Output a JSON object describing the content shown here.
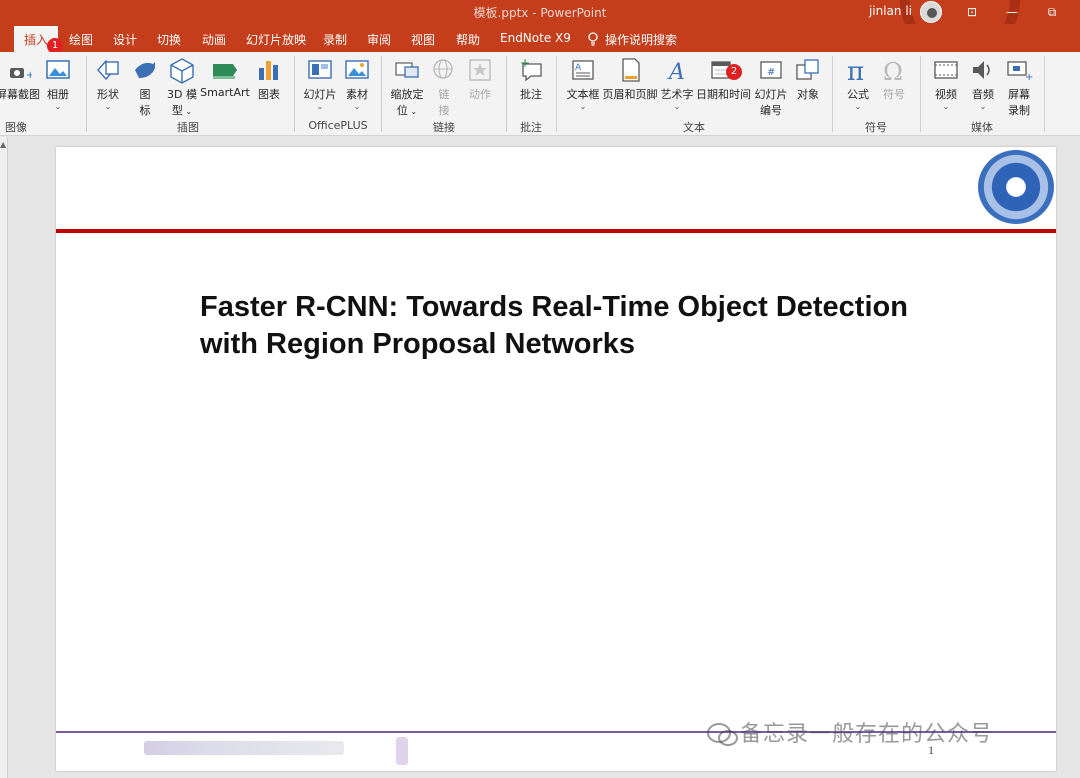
{
  "titlebar": {
    "document_title": "模板.pptx  -  PowerPoint",
    "user_name": "jinlan li",
    "win_buttons": [
      "⊡",
      "—",
      "⧉"
    ]
  },
  "tabs": [
    {
      "label": "插入",
      "active": true
    },
    {
      "label": "绘图"
    },
    {
      "label": "设计"
    },
    {
      "label": "切换"
    },
    {
      "label": "动画"
    },
    {
      "label": "幻灯片放映"
    },
    {
      "label": "录制"
    },
    {
      "label": "审阅"
    },
    {
      "label": "视图"
    },
    {
      "label": "帮助"
    },
    {
      "label": "EndNote X9"
    },
    {
      "label": "操作说明搜索"
    }
  ],
  "badges": {
    "tab_badge": "1",
    "date_badge": "2"
  },
  "ribbon": {
    "images": {
      "screenshot": "屏幕截图",
      "album": "相册",
      "group": "图像"
    },
    "illustrations": {
      "shapes": "形状",
      "icons_1": "图",
      "icons_2": "标",
      "model_1": "3D 模",
      "model_2": "型",
      "smartart": "SmartArt",
      "chart": "图表",
      "group": "插图"
    },
    "officeplus": {
      "slides": "幻灯片",
      "materials": "素材",
      "group": "OfficePLUS"
    },
    "links": {
      "zoom_1": "缩放定",
      "zoom_2": "位",
      "link_1": "链",
      "link_2": "接",
      "action": "动作",
      "group": "链接"
    },
    "comments": {
      "comment": "批注",
      "group": "批注"
    },
    "text": {
      "textbox": "文本框",
      "header_footer": "页眉和页脚",
      "wordart": "艺术字",
      "datetime": "日期和时间",
      "slide_num_1": "幻灯片",
      "slide_num_2": "编号",
      "object": "对象",
      "group": "文本"
    },
    "symbols": {
      "equation": "公式",
      "symbol": "符号",
      "group": "符号"
    },
    "media": {
      "video": "视频",
      "audio": "音频",
      "screen_rec_1": "屏幕",
      "screen_rec_2": "录制",
      "group": "媒体"
    }
  },
  "slide": {
    "title_line1": "Faster R-CNN: Towards Real-Time Object Detection",
    "title_line2": "with Region Proposal Networks",
    "page_number": "1"
  },
  "watermark": "备忘录一般存在的公众号",
  "colors": {
    "accent": "#c43e1c",
    "slide_red_rule": "#c00000",
    "slide_purple_rule": "#7b5aa6"
  }
}
